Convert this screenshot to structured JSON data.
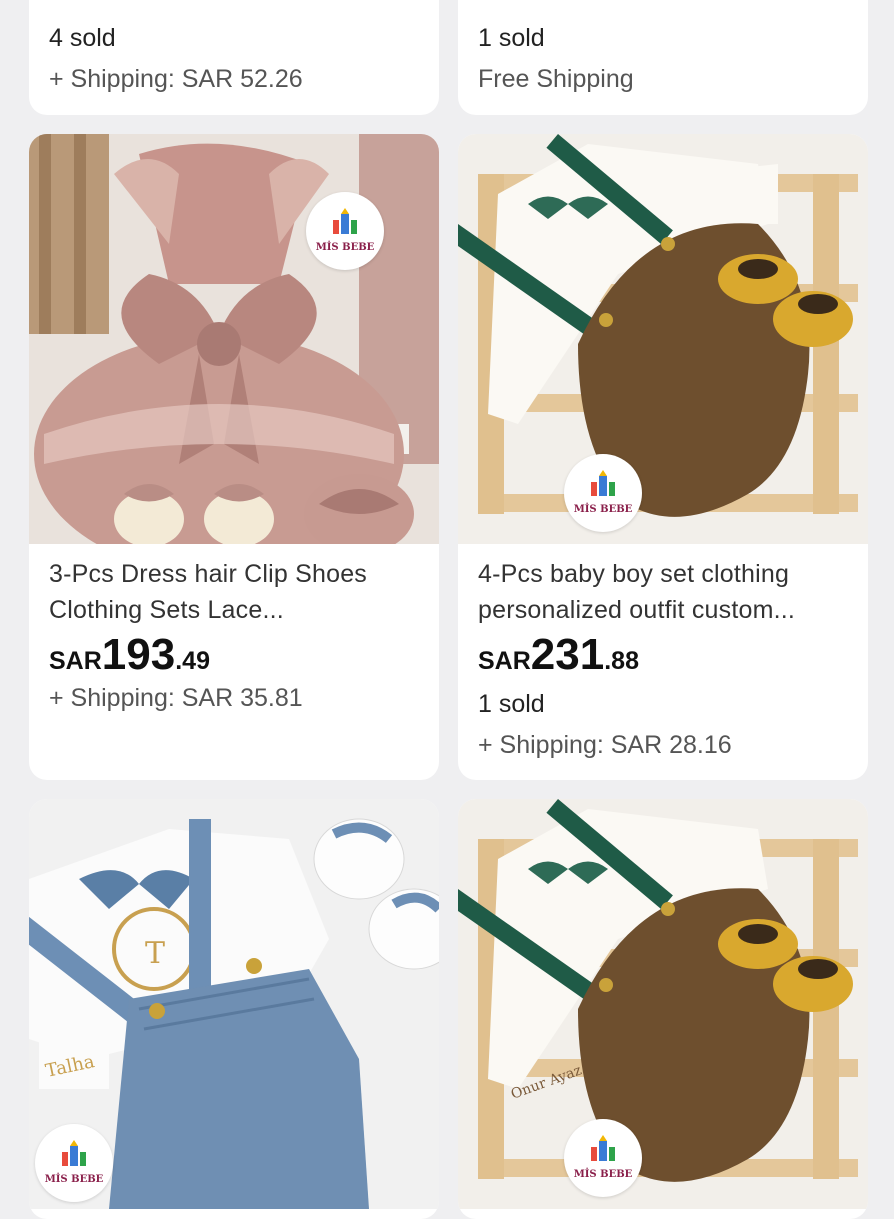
{
  "top_cards": [
    {
      "sold": "4 sold",
      "shipping": "+ Shipping: SAR 52.26"
    },
    {
      "sold": "1 sold",
      "shipping": "Free Shipping"
    }
  ],
  "products": [
    {
      "title_line1": "3-Pcs Dress hair Clip Shoes",
      "title_line2": "Clothing Sets Lace...",
      "currency": "SAR",
      "price_int": "193",
      "price_dec": ".49",
      "sold": "",
      "shipping": "+ Shipping: SAR 35.81",
      "logo_text": "MİS BEBE"
    },
    {
      "title_line1": "4-Pcs baby boy set clothing",
      "title_line2": "personalized outfit custom...",
      "currency": "SAR",
      "price_int": "231",
      "price_dec": ".88",
      "sold": "1 sold",
      "shipping": "+ Shipping: SAR 28.16",
      "logo_text": "MİS BEBE"
    },
    {
      "logo_text": "MİS BEBE",
      "embroidery": "Talha"
    },
    {
      "logo_text": "MİS BEBE",
      "embroidery": "Onur Ayaz"
    }
  ],
  "colors": {
    "background": "#efeff1",
    "card": "#ffffff",
    "text": "#222222",
    "muted": "#555555"
  }
}
